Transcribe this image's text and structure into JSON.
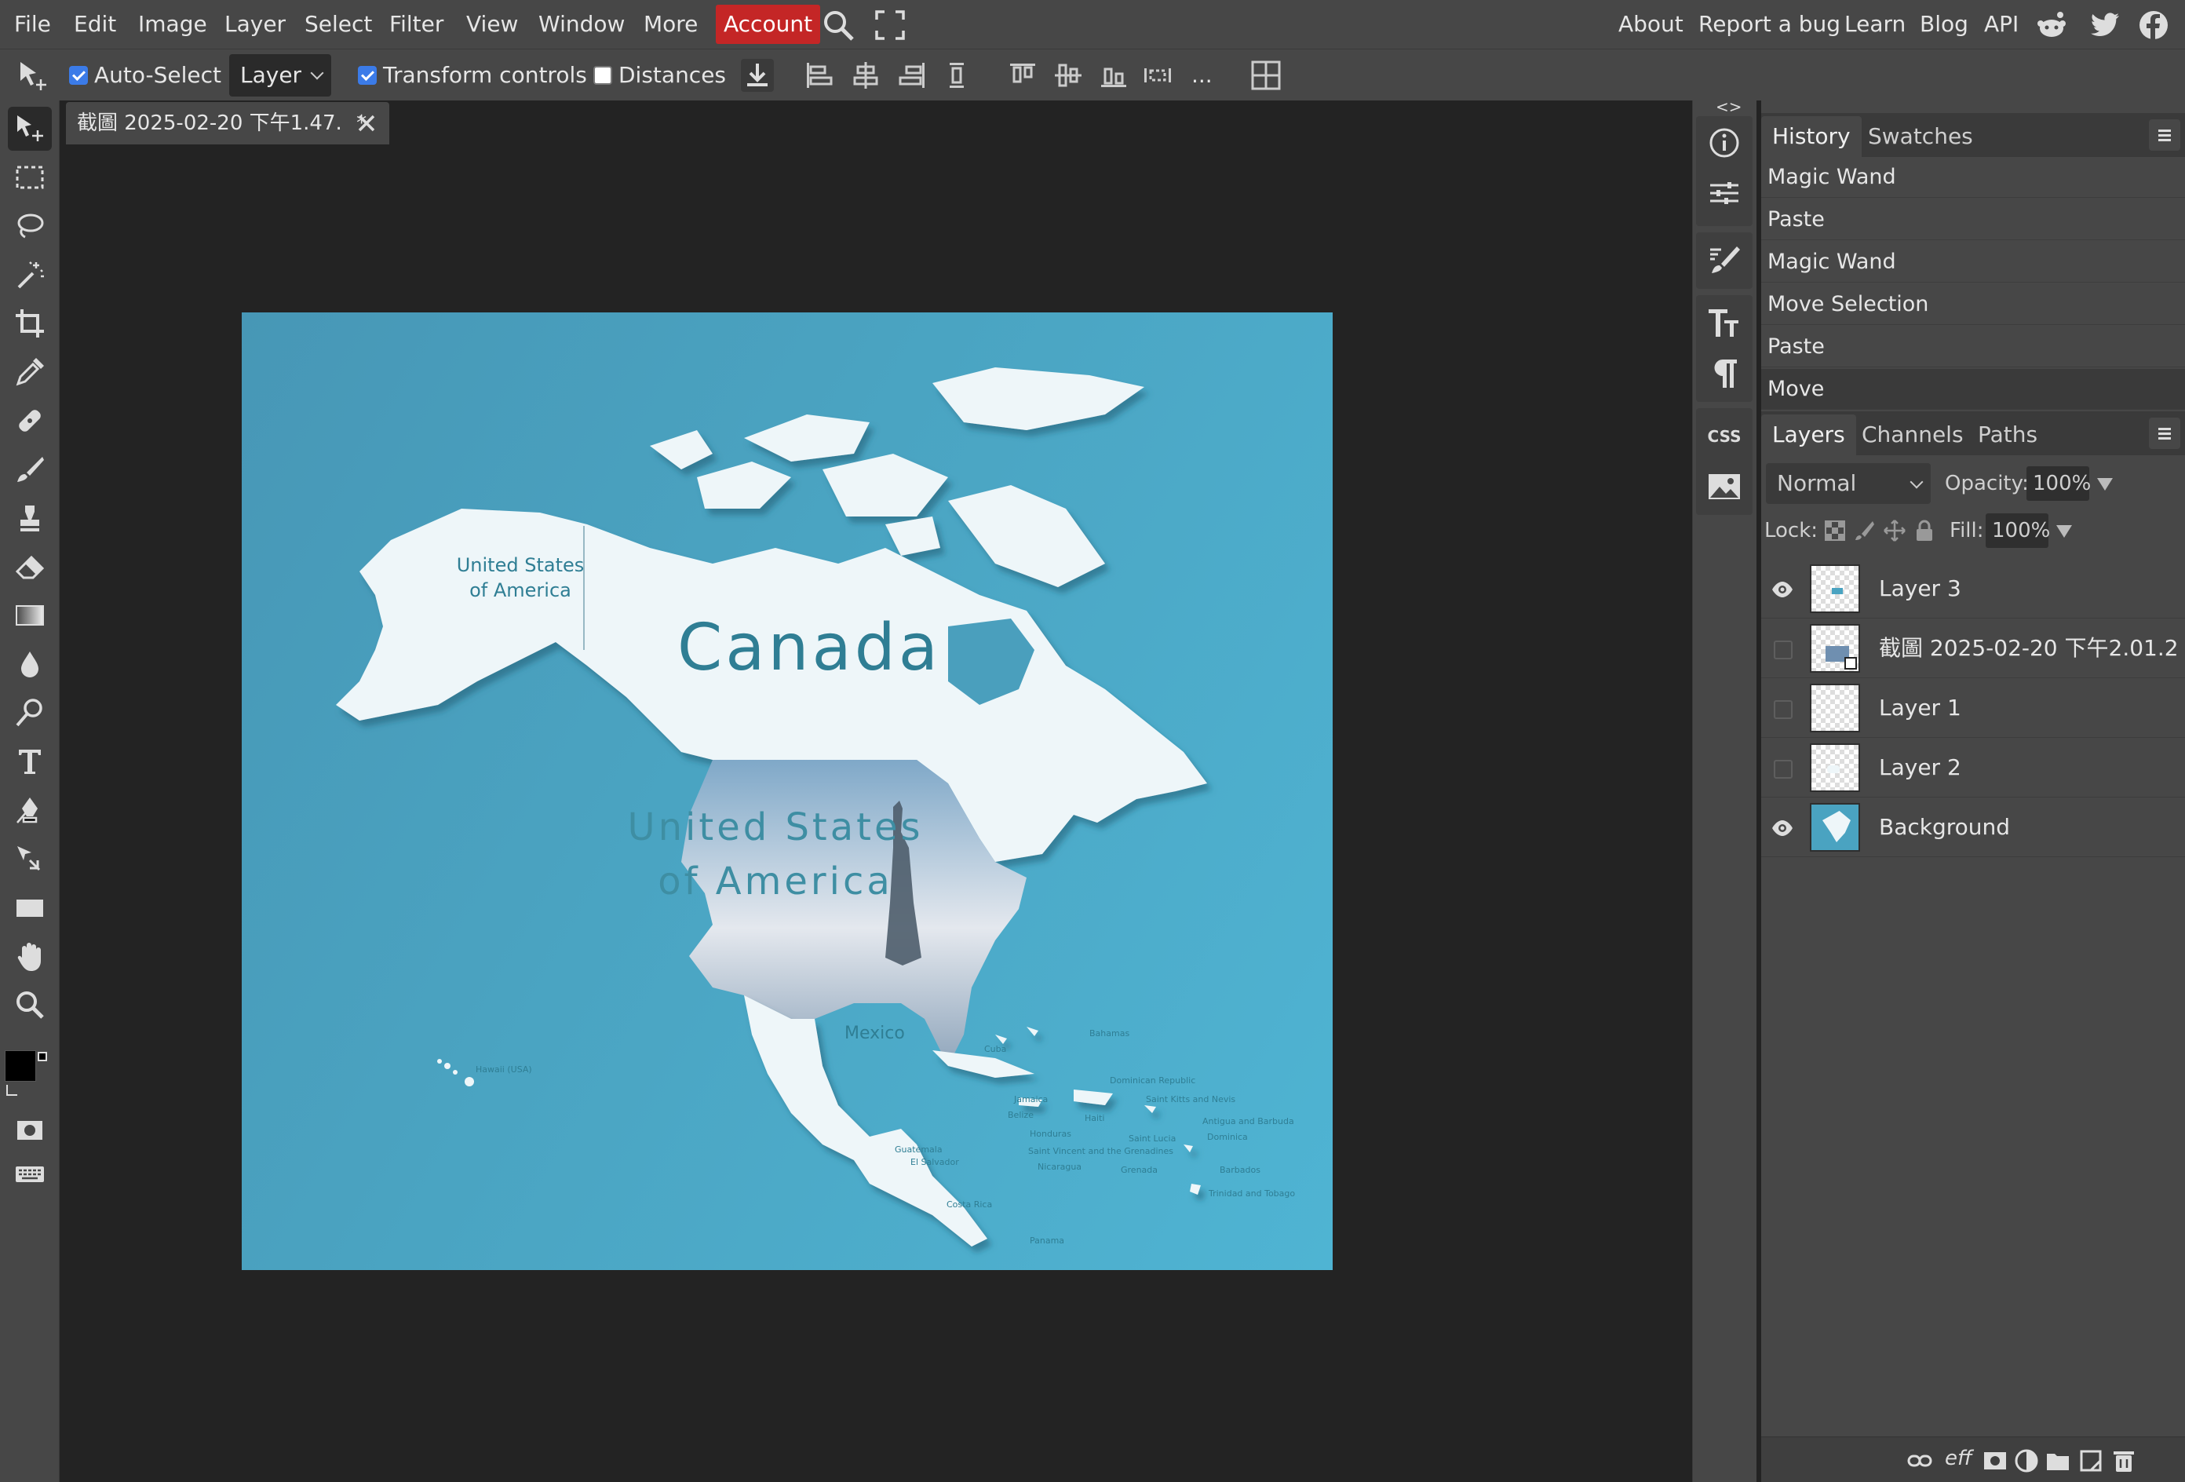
{
  "menu": {
    "items": [
      "File",
      "Edit",
      "Image",
      "Layer",
      "Select",
      "Filter",
      "View",
      "Window",
      "More"
    ],
    "account": "Account",
    "right": [
      "About",
      "Report a bug",
      "Learn",
      "Blog",
      "API"
    ]
  },
  "options": {
    "auto_select": {
      "label": "Auto-Select",
      "checked": true
    },
    "target": "Layer",
    "transform": {
      "label": "Transform controls",
      "checked": true
    },
    "distances": {
      "label": "Distances",
      "checked": false
    },
    "more": "..."
  },
  "document": {
    "tab_title": "截圖 2025-02-20 下午1.47.",
    "modified": "*"
  },
  "map": {
    "canada": "Canada",
    "usa_line1": "United States",
    "usa_line2": "of America",
    "alaska_line1": "United States",
    "alaska_line2": "of America",
    "mexico": "Mexico",
    "hawaii": "Hawaii (USA)",
    "cuba": "Cuba",
    "bahamas": "Bahamas",
    "dominican": "Dominican Republic",
    "saint_kitts": "Saint Kitts and Nevis",
    "antigua": "Antigua and Barbuda",
    "dominica": "Dominica",
    "saint_lucia": "Saint Lucia",
    "barbados": "Barbados",
    "grenada": "Grenada",
    "trinidad": "Trinidad and Tobago",
    "jamaica": "Jamaica",
    "haiti": "Haiti",
    "belize": "Belize",
    "honduras": "Honduras",
    "guatemala": "Guatemala",
    "el_salvador": "El Salvador",
    "nicaragua": "Nicaragua",
    "svg": "Saint Vincent and the Grenadines",
    "costa_rica": "Costa Rica",
    "panama": "Panama",
    "colors": {
      "ocean": "#4aa3c1",
      "land": "#eef6f9",
      "label": "#2f7e94"
    }
  },
  "history": {
    "tabs": [
      "History",
      "Swatches"
    ],
    "items": [
      "Magic Wand",
      "Paste",
      "Magic Wand",
      "Move Selection",
      "Paste",
      "Move"
    ]
  },
  "layers": {
    "tabs": [
      "Layers",
      "Channels",
      "Paths"
    ],
    "blend_mode": "Normal",
    "opacity_label": "Opacity:",
    "opacity": "100%",
    "lock_label": "Lock:",
    "fill_label": "Fill:",
    "fill": "100%",
    "items": [
      {
        "name": "Layer 3",
        "visible": true
      },
      {
        "name": "截圖 2025-02-20 下午2.01.2",
        "visible": false
      },
      {
        "name": "Layer 1",
        "visible": false
      },
      {
        "name": "Layer 2",
        "visible": false
      },
      {
        "name": "Background",
        "visible": true
      }
    ],
    "footer_eff": "eff"
  },
  "side_panel": {
    "css_label": "CSS"
  },
  "colors": {
    "foreground": "#000000",
    "background": "#ffffff",
    "accent": "#c42626",
    "checkbox": "#3b7be8"
  }
}
